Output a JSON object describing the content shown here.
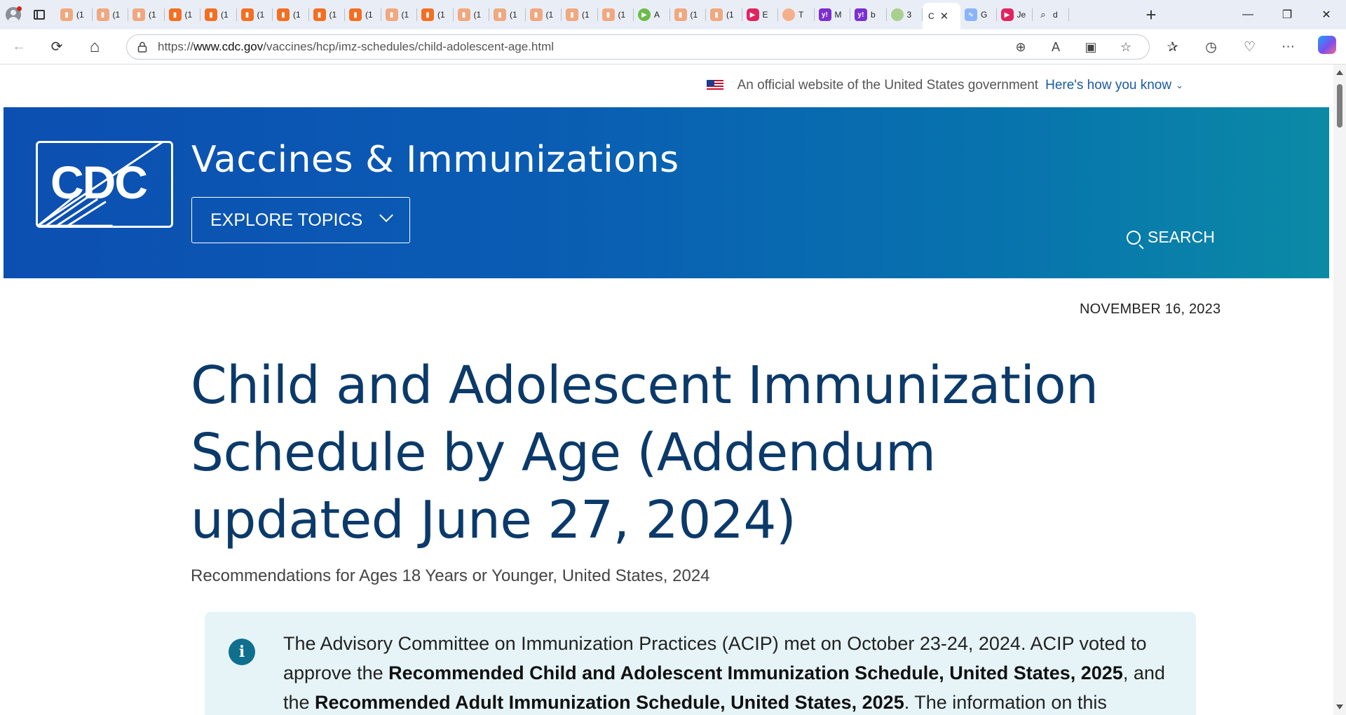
{
  "browser": {
    "mini_tabs": [
      {
        "icon": "bookmark",
        "color": "pale",
        "label": "(1"
      },
      {
        "icon": "bookmark",
        "color": "pale",
        "label": "(1"
      },
      {
        "icon": "bookmark",
        "color": "pale",
        "label": "(1"
      },
      {
        "icon": "bookmark",
        "color": "orange",
        "label": "(1"
      },
      {
        "icon": "bookmark",
        "color": "orange",
        "label": "(1"
      },
      {
        "icon": "bookmark",
        "color": "orange",
        "label": "(1"
      },
      {
        "icon": "bookmark",
        "color": "orange",
        "label": "(1"
      },
      {
        "icon": "bookmark",
        "color": "orange",
        "label": "(1"
      },
      {
        "icon": "bookmark",
        "color": "orange",
        "label": "(1"
      },
      {
        "icon": "bookmark",
        "color": "pale",
        "label": "(1"
      },
      {
        "icon": "bookmark",
        "color": "orange",
        "label": "(1"
      },
      {
        "icon": "bookmark",
        "color": "pale",
        "label": "(1"
      },
      {
        "icon": "bookmark",
        "color": "pale",
        "label": "(1"
      },
      {
        "icon": "bookmark",
        "color": "pale",
        "label": "(1"
      },
      {
        "icon": "bookmark",
        "color": "pale",
        "label": "(1"
      },
      {
        "icon": "bookmark",
        "color": "pale",
        "label": "(1"
      },
      {
        "icon": "play",
        "color": "green",
        "label": "A"
      },
      {
        "icon": "bookmark",
        "color": "pale",
        "label": "(1"
      },
      {
        "icon": "bookmark",
        "color": "pale",
        "label": "(1"
      },
      {
        "icon": "video",
        "color": "yt",
        "label": "E"
      },
      {
        "icon": "circle",
        "color": "circle",
        "label": "T"
      },
      {
        "icon": "yahoo",
        "color": "yahoo",
        "label": "M"
      },
      {
        "icon": "yahoo",
        "color": "yahoo",
        "label": "b"
      },
      {
        "icon": "circle",
        "color": "gray",
        "label": "3"
      }
    ],
    "active_tab": {
      "label": "C",
      "close": "✕"
    },
    "trailing_tabs": [
      {
        "icon": "wave",
        "color": "blue",
        "label": "G"
      },
      {
        "icon": "video",
        "color": "yt",
        "label": "Je"
      },
      {
        "icon": "search",
        "color": "search",
        "label": "d"
      }
    ],
    "new_tab": "+",
    "window_controls": {
      "minimize": "—",
      "restore": "❐",
      "close": "✕"
    },
    "nav": {
      "back": "←",
      "refresh": "⟳",
      "home": "⌂"
    },
    "url_prefix": "https://",
    "url_host": "www.cdc.gov",
    "url_path": "/vaccines/hcp/imz-schedules/child-adolescent-age.html",
    "address_icons": {
      "zoom": "⊕",
      "read_aloud": "A",
      "immersive": "▣",
      "favorite": "☆"
    },
    "toolbar_icons": {
      "favorites": "✰",
      "history": "◷",
      "health": "♡",
      "more": "···"
    }
  },
  "banner": {
    "text": "An official website of the United States government",
    "link": "Here's how you know",
    "link_chevron": "⌄"
  },
  "header": {
    "logo_text": "CDC",
    "site_title": "Vaccines & Immunizations",
    "explore_label": "EXPLORE TOPICS",
    "search_label": "SEARCH"
  },
  "content": {
    "date": "NOVEMBER 16, 2023",
    "title": "Child and Adolescent Immunization Schedule by Age (Addendum updated June 27, 2024)",
    "subtitle": "Recommendations for Ages 18 Years or Younger, United States, 2024",
    "callout": {
      "icon_glyph": "i",
      "text_1": "The Advisory Committee on Immunization Practices (ACIP) met on October 23-24, 2024. ACIP voted to approve the ",
      "bold_1": "Recommended Child and Adolescent Immunization Schedule, United States, 2025",
      "text_2": ", and the ",
      "bold_2": "Recommended Adult Immunization Schedule, United States, 2025",
      "text_3": ". The information on this"
    }
  },
  "colors": {
    "header_start": "#0c4fb2",
    "header_end": "#0b8aa6",
    "title": "#0b3a6a",
    "callout_bg": "#e6f4f7",
    "info_icon": "#0f6f8f"
  }
}
